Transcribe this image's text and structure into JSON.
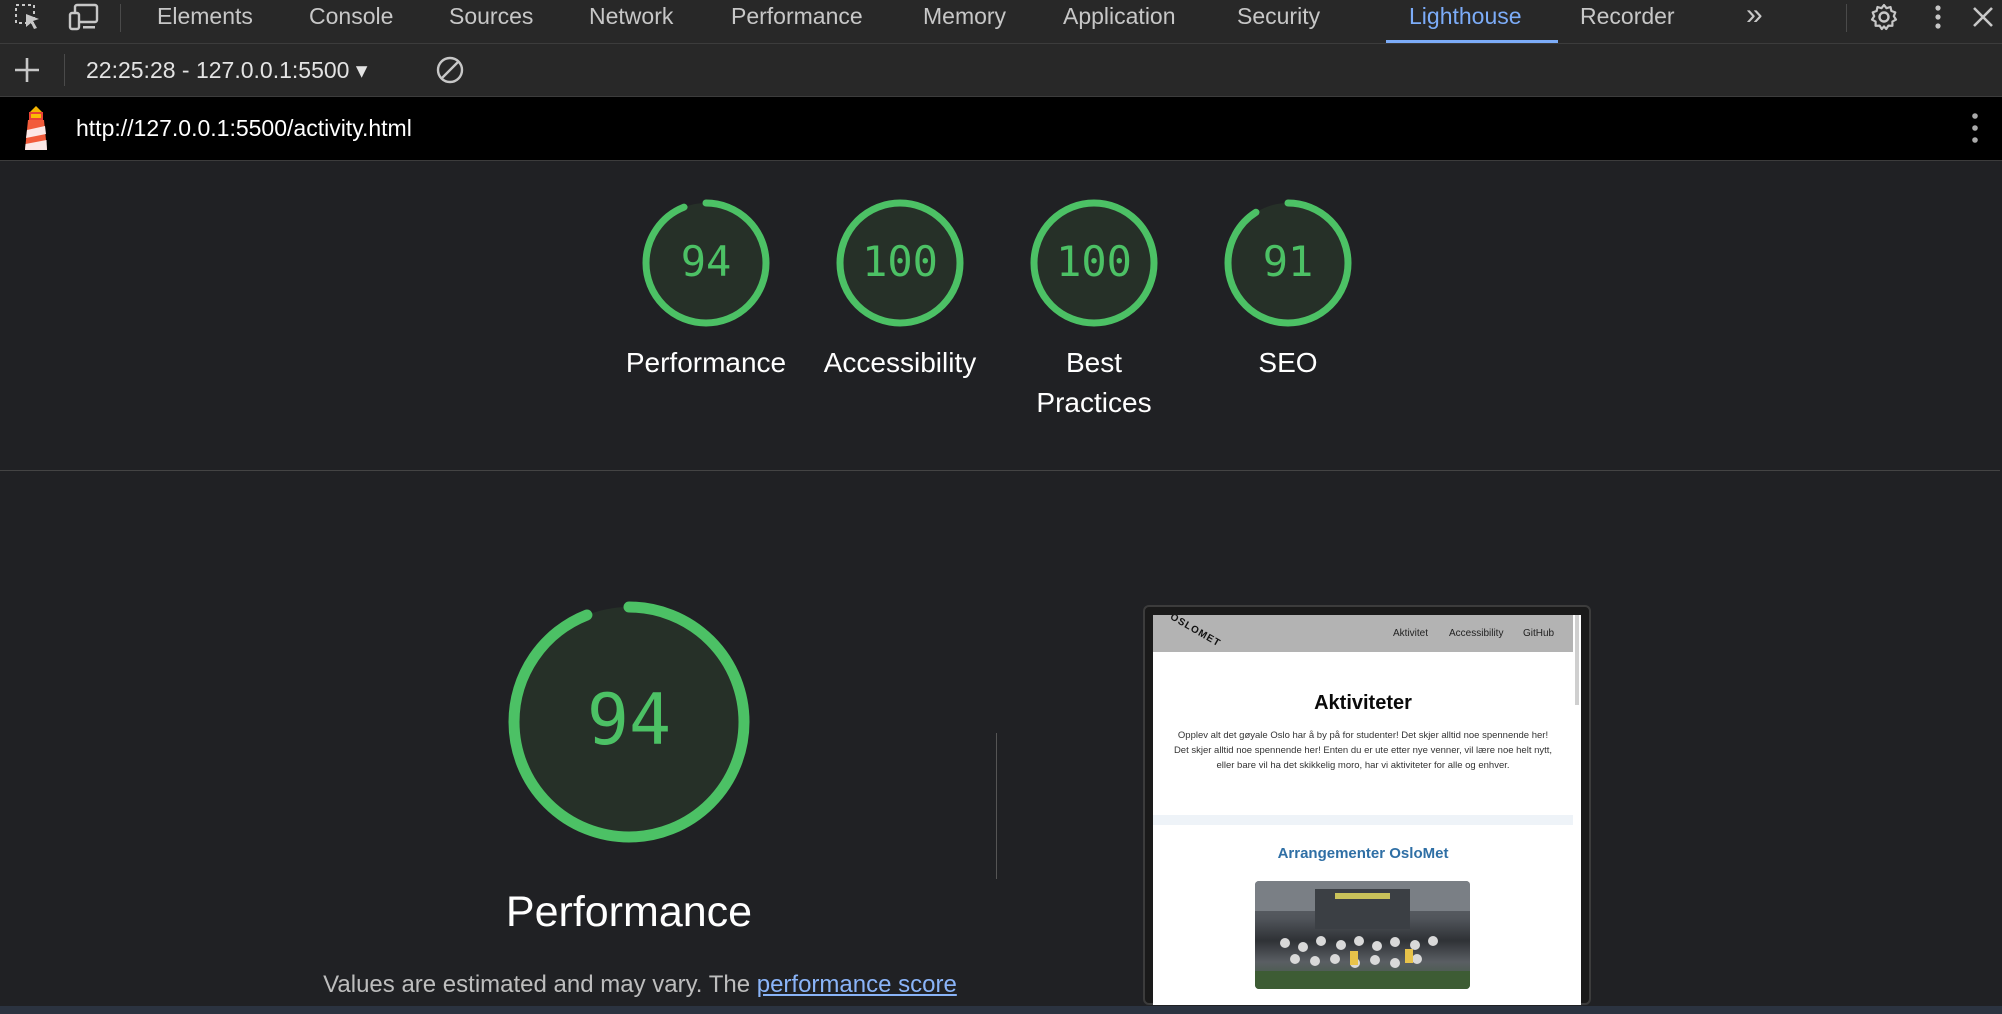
{
  "devtools": {
    "tabs": [
      "Elements",
      "Console",
      "Sources",
      "Network",
      "Performance",
      "Memory",
      "Application",
      "Security",
      "Lighthouse",
      "Recorder"
    ],
    "active_tab": "Lighthouse",
    "more_tabs_glyph": "»",
    "icons": [
      "inspect-element-icon",
      "device-toolbar-icon",
      "settings-icon",
      "more-vert-icon",
      "close-icon"
    ]
  },
  "toolbar": {
    "add_glyph": "+",
    "report_select": "22:25:28 - 127.0.0.1:5500",
    "dropdown_glyph": "▾",
    "clear_icon": "clear-icon"
  },
  "report": {
    "url": "http://127.0.0.1:5500/activity.html",
    "logo_icon": "lighthouse-icon"
  },
  "scores": [
    {
      "label": "Performance",
      "value": 94
    },
    {
      "label": "Accessibility",
      "value": 100
    },
    {
      "label": "Best Practices",
      "value": 100
    },
    {
      "label": "SEO",
      "value": 91
    }
  ],
  "performance": {
    "score": 94,
    "title": "Performance",
    "note_prefix": "Values are estimated and may vary. The ",
    "note_link": "performance score"
  },
  "thumbnail": {
    "logo": "OSLOMET",
    "nav_links": [
      "Aktivitet",
      "Accessibility",
      "GitHub"
    ],
    "heading": "Aktiviteter",
    "paragraph": "Opplev alt det gøyale Oslo har å by på for studenter! Det skjer alltid noe spennende her! Det skjer alltid noe spennende her! Enten du er ute etter nye venner, vil lære noe helt nytt, eller bare vil ha det skikkelig moro, har vi aktiviteter for alle og enhver.",
    "subheading": "Arrangementer OsloMet"
  },
  "colors": {
    "pass": "#0cce6b",
    "gauge_stroke": "#4cc165",
    "gauge_fill": "#26302a",
    "accent": "#7cacf8"
  }
}
